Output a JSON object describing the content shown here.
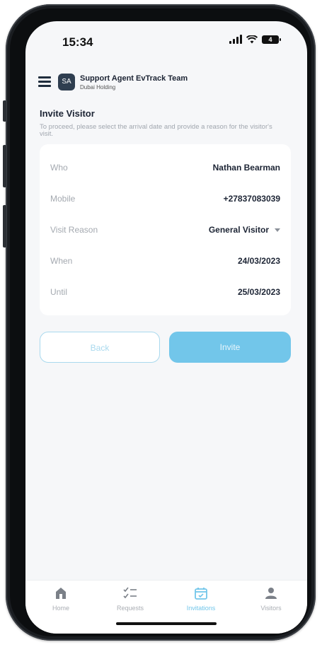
{
  "status": {
    "time": "15:34",
    "battery": "4"
  },
  "header": {
    "avatar": "SA",
    "org_name": "Support Agent EvTrack Team",
    "org_sub": "Dubai Holding"
  },
  "page": {
    "title": "Invite Visitor",
    "description": "To proceed, please select the arrival date and provide a reason for the visitor's visit."
  },
  "form": {
    "rows": [
      {
        "label": "Who",
        "value": "Nathan Bearman"
      },
      {
        "label": "Mobile",
        "value": "+27837083039"
      },
      {
        "label": "Visit Reason",
        "value": "General Visitor"
      },
      {
        "label": "When",
        "value": "24/03/2023"
      },
      {
        "label": "Until",
        "value": "25/03/2023"
      }
    ]
  },
  "actions": {
    "back_label": "Back",
    "invite_label": "Invite"
  },
  "nav": {
    "items": [
      {
        "label": "Home",
        "icon": "home-icon"
      },
      {
        "label": "Requests",
        "icon": "checklist-icon"
      },
      {
        "label": "Invitations",
        "icon": "calendar-check-icon",
        "active": true
      },
      {
        "label": "Visitors",
        "icon": "person-icon"
      }
    ]
  },
  "colors": {
    "accent": "#72c6ea",
    "outline": "#a9d9ee",
    "text_dark": "#1c2434"
  }
}
